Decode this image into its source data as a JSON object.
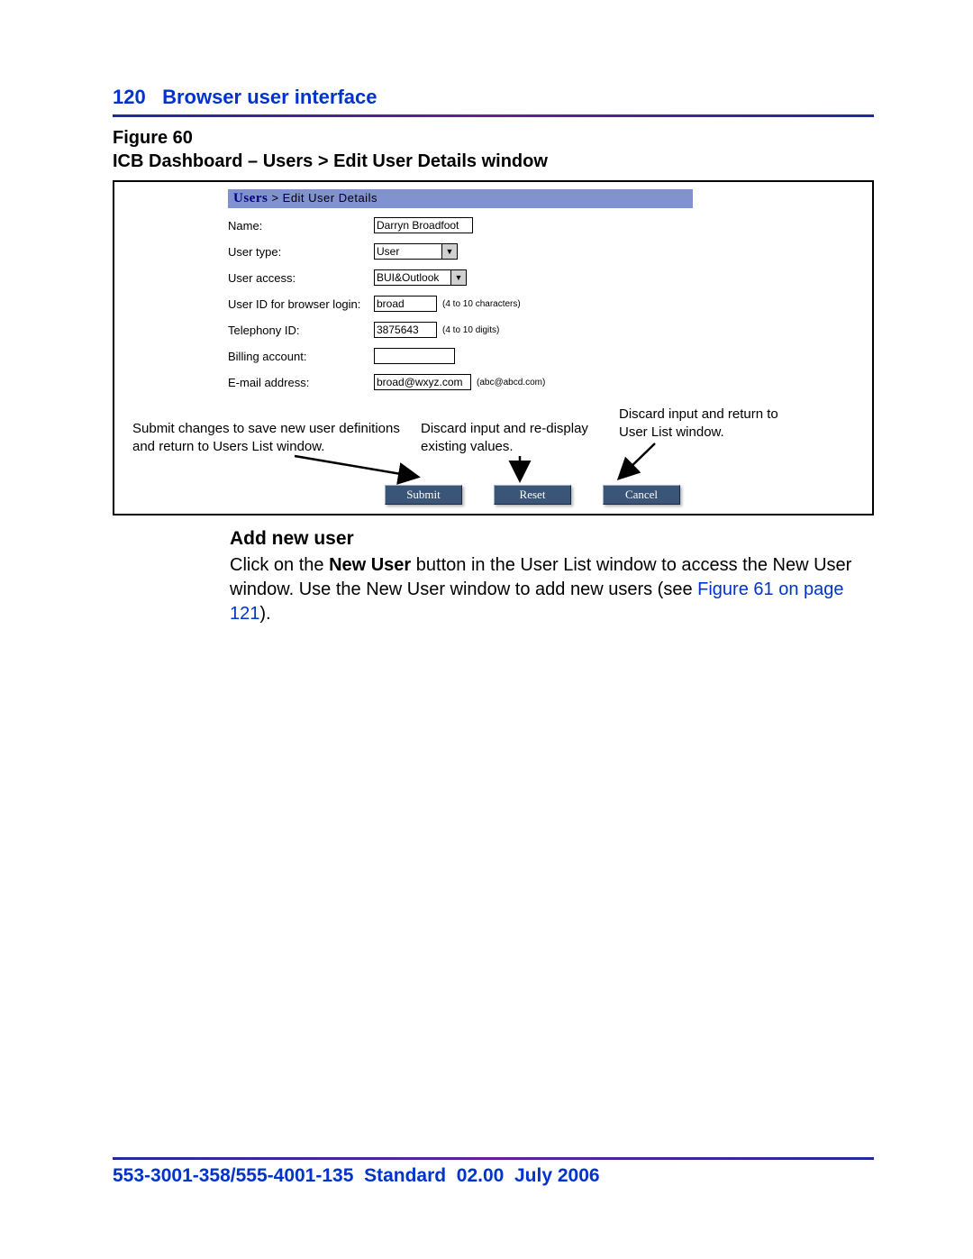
{
  "header": {
    "page_number": "120",
    "section_title": "Browser user interface"
  },
  "figure": {
    "label": "Figure 60",
    "title": "ICB Dashboard – Users > Edit User Details window"
  },
  "panel": {
    "breadcrumb_strong": "Users",
    "breadcrumb_rest": " > Edit User Details"
  },
  "form": {
    "name_label": "Name:",
    "name_value": "Darryn Broadfoot",
    "user_type_label": "User type:",
    "user_type_value": "User",
    "user_access_label": "User access:",
    "user_access_value": "BUI&Outlook",
    "user_id_label": "User ID for browser login:",
    "user_id_value": "broad",
    "user_id_hint": "(4 to 10 characters)",
    "telephony_label": "Telephony ID:",
    "telephony_value": "3875643",
    "telephony_hint": "(4 to 10 digits)",
    "billing_label": "Billing account:",
    "billing_value": "",
    "email_label": "E-mail address:",
    "email_value": "broad@wxyz.com",
    "email_hint": "(abc@abcd.com)"
  },
  "callouts": {
    "left": "Submit changes to save new user definitions and return to Users List window.",
    "mid": "Discard input and re-display existing values.",
    "right": "Discard input and return to User List window."
  },
  "buttons": {
    "submit": "Submit",
    "reset": "Reset",
    "cancel": "Cancel"
  },
  "body": {
    "subheading": "Add new user",
    "text_pre": "Click on the ",
    "text_bold": "New User",
    "text_mid": " button in the User List window to access the New User window. Use the New User window to add new users (see ",
    "link": "Figure 61 on page 121",
    "text_post": ")."
  },
  "footer": {
    "doc_id": "553-3001-358/555-4001-135",
    "standard": "Standard",
    "version": "02.00",
    "date": "July 2006"
  }
}
